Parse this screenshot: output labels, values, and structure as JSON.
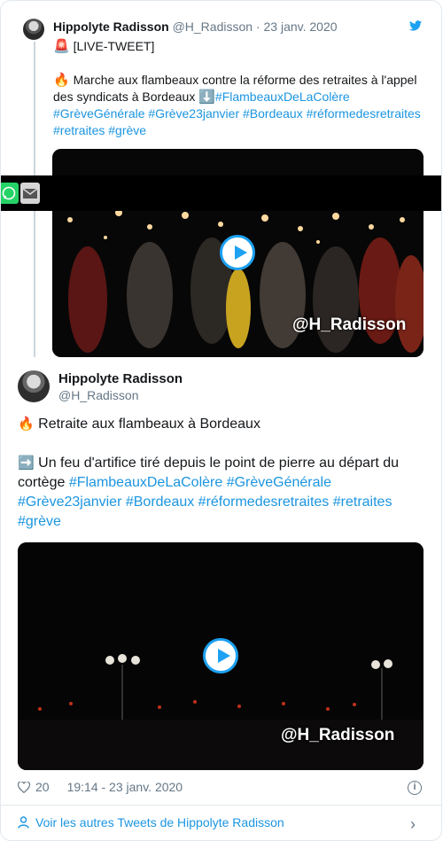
{
  "quoted": {
    "name": "Hippolyte Radisson",
    "handle": "@H_Radisson",
    "date": "23 janv. 2020",
    "live_label": "[LIVE-TWEET]",
    "text_main": "Marche aux flambeaux contre la réforme des retraites à l'appel des syndicats à Bordeaux ",
    "hashtags_line1": "#FlambeauxDeLaColère",
    "hashtags_line2": "#GrèveGénérale #Grève23janvier #Bordeaux #réformedesretraites",
    "hashtags_line3": "#retraites #grève",
    "video_watermark": "@H_Radisson"
  },
  "main": {
    "name": "Hippolyte Radisson",
    "handle": "@H_Radisson",
    "line1": "Retraite aux flambeaux à Bordeaux",
    "line2_text": "Un feu d'artifice tiré depuis le point de pierre au départ du cortège ",
    "hashtags_a": "#FlambeauxDeLaColère #GrèveGénérale",
    "hashtags_b": "#Grève23janvier #Bordeaux #réformedesretraites #retraites",
    "hashtags_c": "#grève",
    "video_watermark": "@H_Radisson",
    "likes": "20",
    "timestamp": "19:14 - 23 janv. 2020",
    "more_link": "Voir les autres Tweets de Hippolyte Radisson"
  },
  "icons": [
    "twitter-bird-icon",
    "rotating-light-icon",
    "fire-icon",
    "down-arrow-icon",
    "right-arrow-icon",
    "play-icon",
    "heart-icon",
    "info-icon",
    "person-icon",
    "chevron-right-icon",
    "whatsapp-icon",
    "email-icon"
  ],
  "colors": {
    "link": "#1b95e0",
    "accent": "#1da1f2",
    "muted": "#657786"
  }
}
